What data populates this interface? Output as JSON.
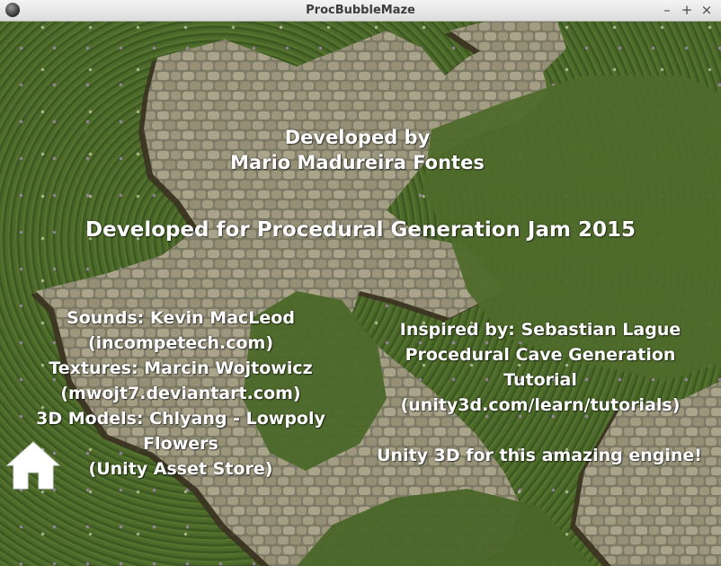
{
  "window": {
    "title": "ProcBubbleMaze",
    "controls": {
      "minimize": "–",
      "maximize": "+",
      "close": "×"
    }
  },
  "credits": {
    "developed_by": [
      "Developed by",
      "Mario Madureira Fontes"
    ],
    "jam": "Developed for Procedural Generation Jam 2015",
    "left": [
      "Sounds: Kevin MacLeod",
      "(incompetech.com)",
      "Textures: Marcin Wojtowicz",
      "(mwojt7.deviantart.com)",
      "3D Models: Chlyang - Lowpoly",
      "Flowers",
      "(Unity Asset Store)"
    ],
    "right": [
      "Inspired by: Sebastian Lague",
      "Procedural Cave Generation",
      "Tutorial",
      "(unity3d.com/learn/tutorials)"
    ],
    "unity": "Unity 3D for this amazing engine!"
  },
  "icons": {
    "home": "home-icon",
    "app": "app-icon"
  },
  "colors": {
    "grass": "#4d6a2a",
    "cobblestone": "#8f8a72",
    "text": "#ffffff",
    "titlebar": "#e4e4e4"
  }
}
